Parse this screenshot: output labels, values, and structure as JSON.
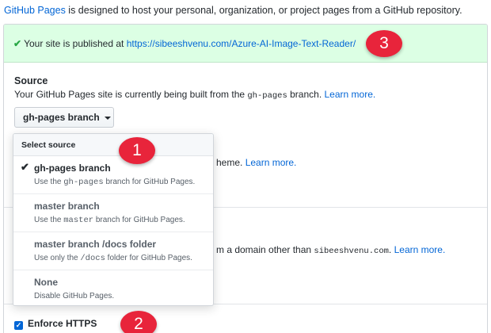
{
  "intro": {
    "link": "GitHub Pages",
    "text": " is designed to host your personal, organization, or project pages from a GitHub repository."
  },
  "flash": {
    "prefix": "Your site is published at ",
    "url": "https://sibeeshvenu.com/Azure-AI-Image-Text-Reader/"
  },
  "source": {
    "title": "Source",
    "desc_before": "Your GitHub Pages site is currently being built from the ",
    "desc_code": "gh-pages",
    "desc_after": " branch. ",
    "learn_more": "Learn more.",
    "button_label": "gh-pages branch"
  },
  "theme": {
    "text": "heme. ",
    "learn_more": "Learn more."
  },
  "domain": {
    "text_before": "m a domain other than ",
    "domain_code": "sibeeshvenu.com",
    "text_after": ". ",
    "learn_more": "Learn more."
  },
  "menu": {
    "header": "Select source",
    "items": [
      {
        "title": "gh-pages branch",
        "desc_before": "Use the ",
        "code": "gh-pages",
        "desc_after": " branch for GitHub Pages.",
        "selected": true
      },
      {
        "title": "master branch",
        "desc_before": "Use the ",
        "code": "master",
        "desc_after": " branch for GitHub Pages.",
        "selected": false
      },
      {
        "title": "master branch /docs folder",
        "desc_before": "Use only the ",
        "code": "/docs",
        "desc_after": " folder for GitHub Pages.",
        "selected": false
      },
      {
        "title": "None",
        "desc_before": "Disable GitHub Pages.",
        "code": "",
        "desc_after": "",
        "selected": false
      }
    ]
  },
  "https": {
    "label": "Enforce HTTPS",
    "checked": true
  },
  "badges": [
    "1",
    "2",
    "3"
  ],
  "icons": {
    "check": "check-icon",
    "caret": "caret-down-icon"
  },
  "colors": {
    "link": "#0366d6",
    "flash_bg": "#dcffe4",
    "badge": "#e8243b",
    "success": "#28a745"
  }
}
